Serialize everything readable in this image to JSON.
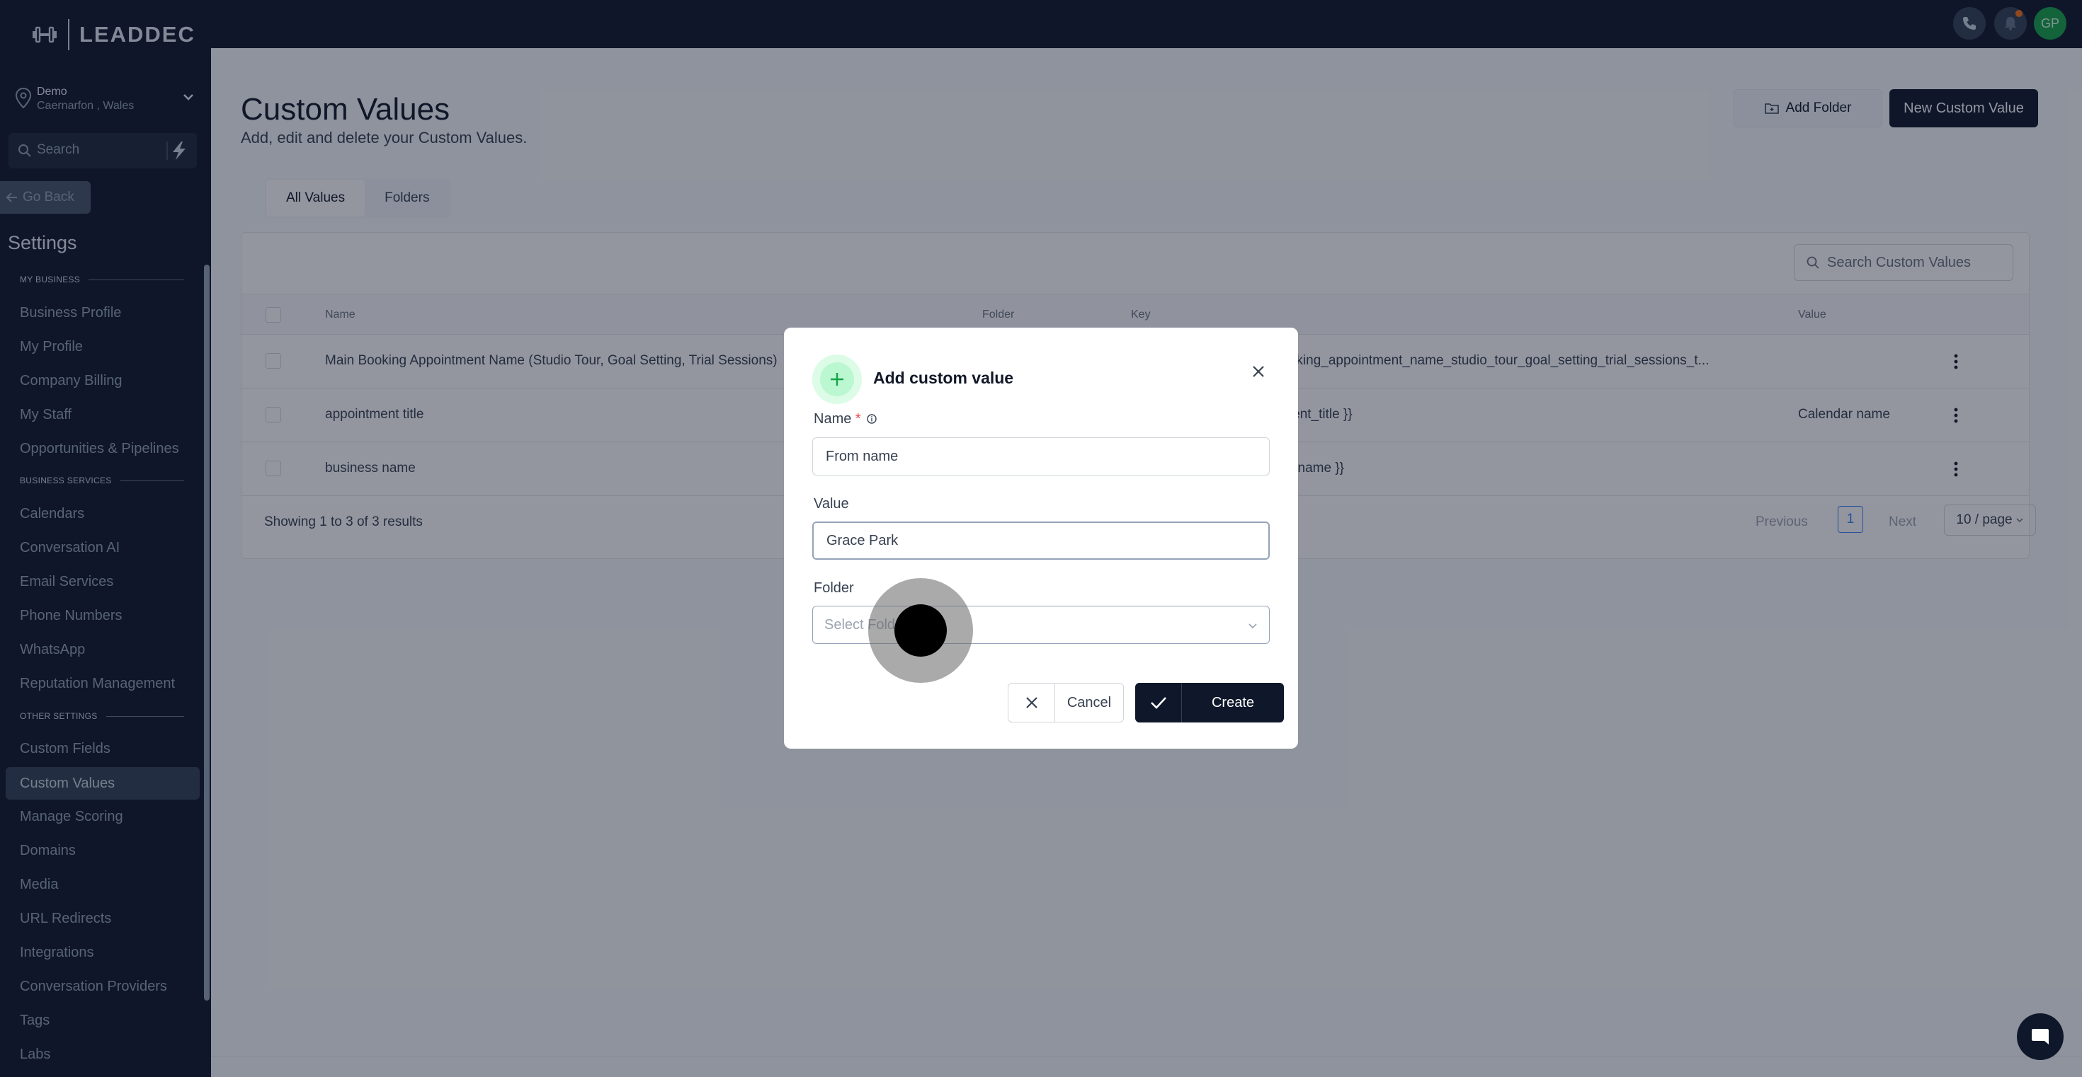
{
  "brand": {
    "name": "LEADDEC"
  },
  "location": {
    "name": "Demo",
    "address": "Caernarfon , Wales"
  },
  "sidebar": {
    "search_placeholder": "Search",
    "go_back": "Go Back",
    "title": "Settings",
    "sections": {
      "my_business": "MY BUSINESS",
      "business_services": "BUSINESS SERVICES",
      "other_settings": "OTHER SETTINGS"
    },
    "items": [
      "Business Profile",
      "My Profile",
      "Company Billing",
      "My Staff",
      "Opportunities & Pipelines",
      "Calendars",
      "Conversation AI",
      "Email Services",
      "Phone Numbers",
      "WhatsApp",
      "Reputation Management",
      "Custom Fields",
      "Custom Values",
      "Manage Scoring",
      "Domains",
      "Media",
      "URL Redirects",
      "Integrations",
      "Conversation Providers",
      "Tags",
      "Labs"
    ],
    "active_item": "Custom Values"
  },
  "topbar": {
    "avatar_initials": "GP"
  },
  "page": {
    "title": "Custom Values",
    "subtitle": "Add, edit and delete your Custom Values.",
    "add_folder_label": "Add Folder",
    "new_value_label": "New Custom Value",
    "tabs": [
      "All Values",
      "Folders"
    ],
    "search_placeholder": "Search Custom Values"
  },
  "table": {
    "columns": [
      "Name",
      "Folder",
      "Key",
      "Value"
    ],
    "rows": [
      {
        "name": "Main Booking Appointment Name (Studio Tour, Goal Setting, Trial Sessions)",
        "key": "{{ custom_values.main_booking_appointment_name_studio_tour_goal_setting_trial_sessions_t...",
        "value": ""
      },
      {
        "name": "appointment title",
        "key": "{{ custom_values.appointment_title }}",
        "value": "Calendar name"
      },
      {
        "name": "business name",
        "key": "{{ custom_values.business_name }}",
        "value": ""
      }
    ],
    "footer": "Showing 1 to 3 of 3 results",
    "pagination": {
      "previous": "Previous",
      "current": "1",
      "next": "Next",
      "page_size": "10 / page"
    }
  },
  "modal": {
    "title": "Add custom value",
    "name_label": "Name",
    "name_required": "*",
    "name_value": "From name",
    "value_label": "Value",
    "value_value": "Grace Park",
    "folder_label": "Folder",
    "folder_placeholder": "Select Folder",
    "cancel_label": "Cancel",
    "create_label": "Create"
  },
  "colors": {
    "sidebar_bg": "#0f172a",
    "accent_green": "#16a34a",
    "primary_button": "#0f172a",
    "required": "#ef4444"
  }
}
